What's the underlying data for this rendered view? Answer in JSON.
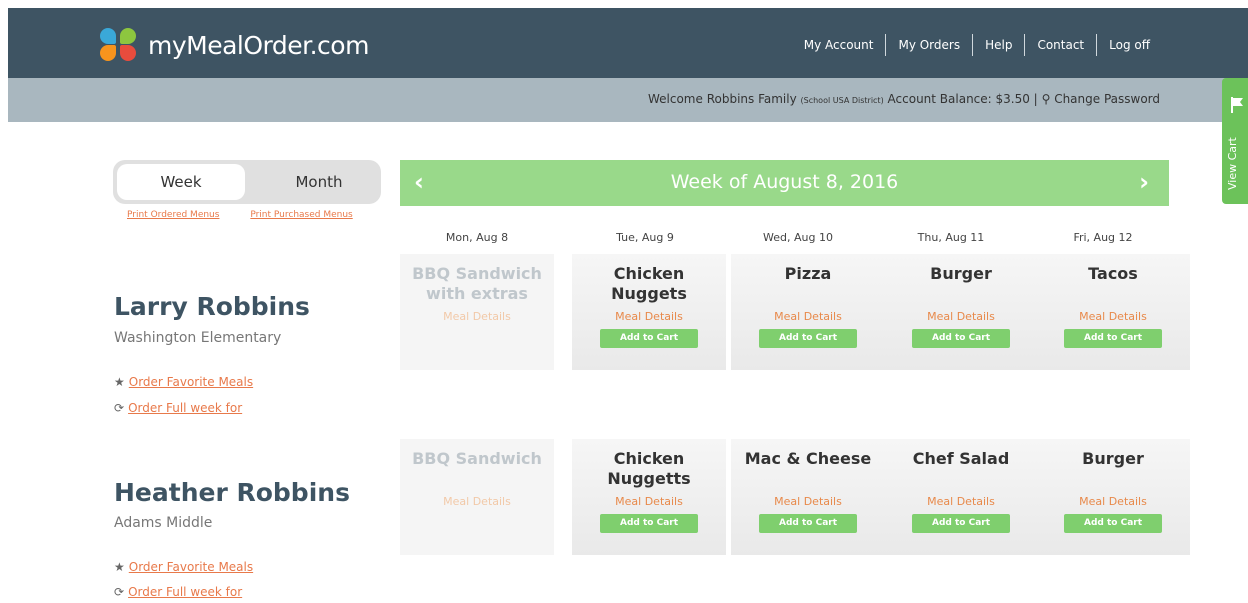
{
  "header": {
    "logo_text": "myMealOrder.com",
    "nav": [
      "My Account",
      "My Orders",
      "Help",
      "Contact",
      "Log off"
    ]
  },
  "subbar": {
    "welcome": "Welcome Robbins Family",
    "district": "(School USA District)",
    "balance": "Account Balance: $3.50 |",
    "change_password": "Change Password"
  },
  "cart": {
    "label": "View Cart"
  },
  "toggle": {
    "week": "Week",
    "month": "Month"
  },
  "print_links": {
    "ordered": "Print Ordered Menus",
    "purchased": "Print Purchased Menus"
  },
  "calendar": {
    "title": "Week of August 8, 2016",
    "days": [
      "Mon, Aug 8",
      "Tue, Aug 9",
      "Wed, Aug 10",
      "Thu, Aug 11",
      "Fri, Aug 12"
    ]
  },
  "labels": {
    "meal_details": "Meal Details",
    "add_to_cart": "Add to Cart"
  },
  "students": [
    {
      "name": "Larry Robbins",
      "school": "Washington Elementary",
      "favorite_link": "Order Favorite Meals",
      "fullweek_link": "Order Full week for",
      "meals": [
        "BBQ Sandwich with extras",
        "Chicken Nuggets",
        "Pizza",
        "Burger",
        "Tacos"
      ]
    },
    {
      "name": "Heather Robbins",
      "school": "Adams Middle",
      "favorite_link": "Order Favorite Meals",
      "fullweek_link": "Order Full week for",
      "meals": [
        "BBQ Sandwich",
        "Chicken Nuggetts",
        "Mac & Cheese",
        "Chef Salad",
        "Burger"
      ]
    }
  ],
  "colors": {
    "header": "#3e5463",
    "subbar": "#a9b7bf",
    "green": "#99d98a",
    "button": "#7fcf6e",
    "link": "#e8794a"
  }
}
